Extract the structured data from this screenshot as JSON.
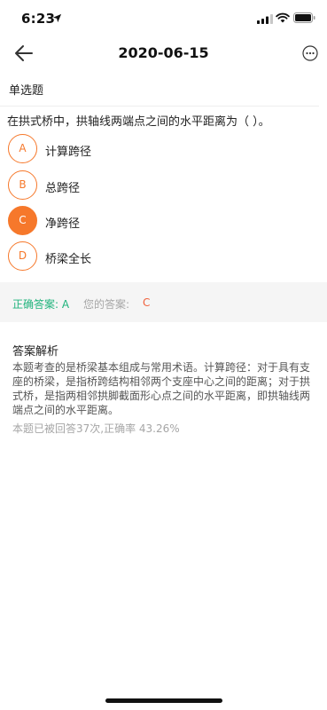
{
  "status_bar": {
    "time": "6:23",
    "icons": [
      "location-arrow-icon",
      "signal-bars-icon",
      "wifi-icon",
      "battery-icon"
    ]
  },
  "nav": {
    "title": "2020-06-15",
    "back_icon": "arrow-left-icon",
    "more_icon": "more-circle-icon"
  },
  "question": {
    "type": "单选题",
    "text": "在拱式桥中，拱轴线两端点之间的水平距离为（    ）。",
    "options": [
      {
        "letter": "A",
        "label": "计算跨径",
        "selected": false
      },
      {
        "letter": "B",
        "label": "总跨径",
        "selected": false
      },
      {
        "letter": "C",
        "label": "净跨径",
        "selected": true
      },
      {
        "letter": "D",
        "label": "桥梁全长",
        "selected": false
      }
    ]
  },
  "answer": {
    "correct_text": "正确答案: A",
    "yours_label": "您的答案:",
    "yours_value": "C"
  },
  "analysis": {
    "title": "答案解析",
    "text": "本题考查的是桥梁基本组成与常用术语。计算跨径：对于具有支座的桥梁，是指桥跨结构相邻两个支座中心之间的距离；对于拱式桥，是指两相邻拱脚截面形心点之间的水平距离，即拱轴线两端点之间的水平距离。",
    "stats": "本题已被回答37次,正确率 43.26%"
  },
  "colors": {
    "accent": "#f6782b",
    "correct": "#1fb37c",
    "wrong": "#f0613c",
    "muted": "#a6a6a6",
    "answer_bar_bg": "#f5f5f5"
  }
}
